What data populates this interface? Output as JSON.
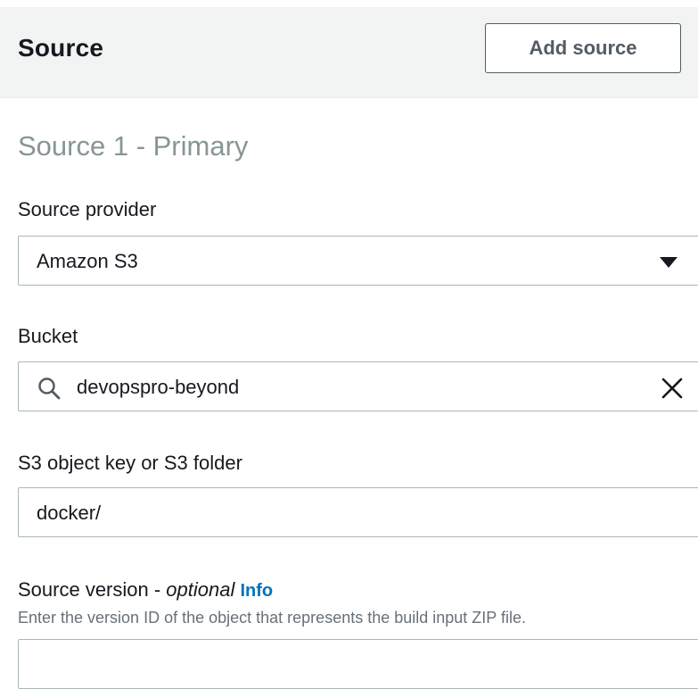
{
  "header": {
    "title": "Source",
    "add_source_label": "Add source"
  },
  "section": {
    "heading": "Source 1 - Primary"
  },
  "source_provider": {
    "label": "Source provider",
    "selected": "Amazon S3",
    "icon": "caret-down-icon"
  },
  "bucket": {
    "label": "Bucket",
    "value": "devopspro-beyond",
    "leading_icon": "search-icon",
    "trailing_icon": "close-icon"
  },
  "object_key": {
    "label": "S3 object key or S3 folder",
    "value": "docker/"
  },
  "source_version": {
    "label": "Source version - ",
    "optional": "optional",
    "info": "Info",
    "description": "Enter the version ID of the object that represents the build input ZIP file.",
    "value": ""
  },
  "colors": {
    "header_bg": "#f2f3f3",
    "border": "#aab7b8",
    "link": "#0073bb",
    "muted_heading": "#879596"
  }
}
